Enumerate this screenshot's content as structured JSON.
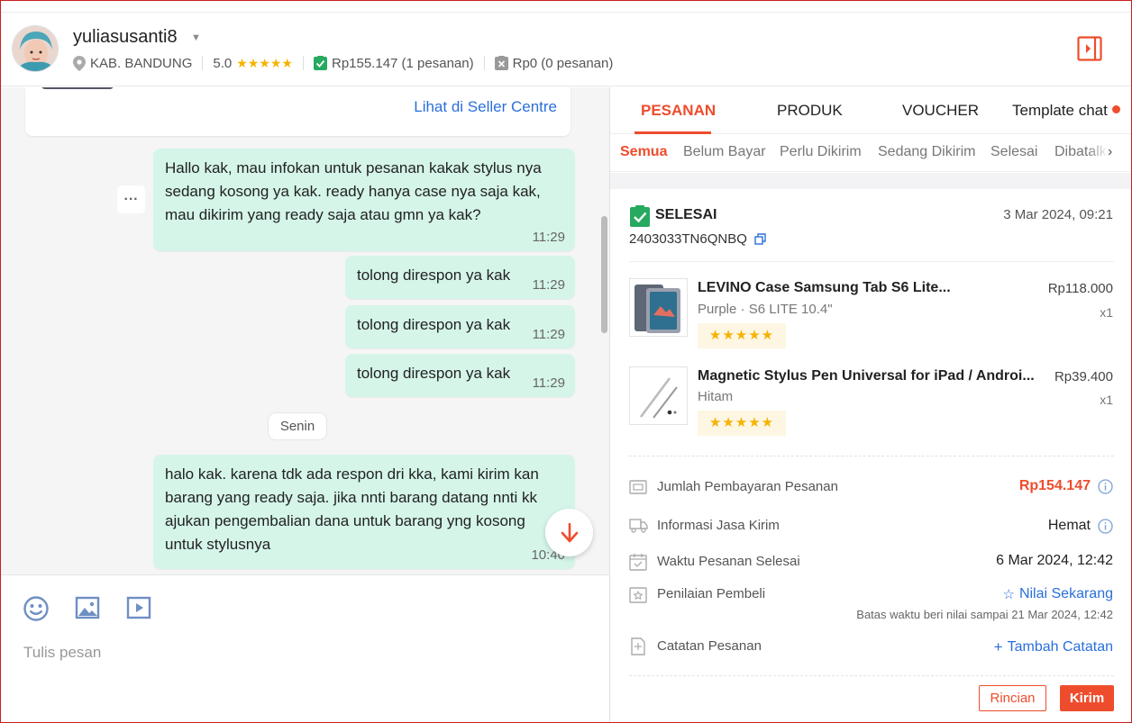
{
  "header": {
    "username": "yuliasusanti8",
    "location": "KAB. BANDUNG",
    "rating": "5.0",
    "rating_stars": "★★★★★",
    "completed_orders": "Rp155.147 (1 pesanan)",
    "cancelled_orders": "Rp0 (0 pesanan)"
  },
  "chat": {
    "seller_link": "Lihat di Seller Centre",
    "day_separator": "Senin",
    "more_label": "···",
    "messages": [
      {
        "text": "Hallo kak, mau infokan untuk pesanan kakak stylus nya sedang kosong ya kak. ready hanya case nya saja kak, mau dikirim yang ready saja atau gmn ya kak?",
        "time": "11:29"
      },
      {
        "text": "tolong direspon ya kak",
        "time": "11:29"
      },
      {
        "text": "tolong direspon ya kak",
        "time": "11:29"
      },
      {
        "text": "tolong direspon ya kak",
        "time": "11:29"
      },
      {
        "text": "halo kak. karena tdk ada respon dri kka, kami kirim kan barang yang ready saja. jika nnti barang datang nnti kk ajukan pengembalian dana untuk barang yng kosong untuk stylusnya",
        "time": "10:40"
      }
    ]
  },
  "composer": {
    "placeholder": "Tulis pesan"
  },
  "panel": {
    "tabs": [
      "PESANAN",
      "PRODUK",
      "VOUCHER",
      "Template chat"
    ],
    "subtabs": [
      "Semua",
      "Belum Bayar",
      "Perlu Dikirim",
      "Sedang Dikirim",
      "Selesai",
      "Dibatalkan"
    ],
    "subtab_arrow": "›",
    "order": {
      "status": "SELESAI",
      "date": "3 Mar 2024, 09:21",
      "order_id": "2403033TN6QNBQ",
      "items": [
        {
          "name": "LEVINO Case Samsung Tab S6 Lite...",
          "variant": "Purple · S6 LITE 10.4\"",
          "price": "Rp118.000",
          "qty": "x1",
          "rating_stars": "★★★★★"
        },
        {
          "name": "Magnetic Stylus Pen Universal for iPad / Androi...",
          "variant": "Hitam",
          "price": "Rp39.400",
          "qty": "x1",
          "rating_stars": "★★★★★"
        }
      ],
      "payment_label": "Jumlah Pembayaran Pesanan",
      "payment_value": "Rp154.147",
      "shipping_label": "Informasi Jasa Kirim",
      "shipping_value": "Hemat",
      "completed_label": "Waktu Pesanan Selesai",
      "completed_value": "6 Mar 2024, 12:42",
      "review_label": "Penilaian Pembeli",
      "review_link": "Nilai Sekarang",
      "review_deadline": "Batas waktu beri nilai sampai 21 Mar 2024, 12:42",
      "notes_label": "Catatan Pesanan",
      "notes_link": "Tambah Catatan"
    },
    "buttons": {
      "detail": "Rincian",
      "send": "Kirim"
    }
  },
  "colors": {
    "accent": "#ee4d2d",
    "bubble": "#d5f5e9",
    "link": "#2a6fdb",
    "star": "#f5b301"
  }
}
